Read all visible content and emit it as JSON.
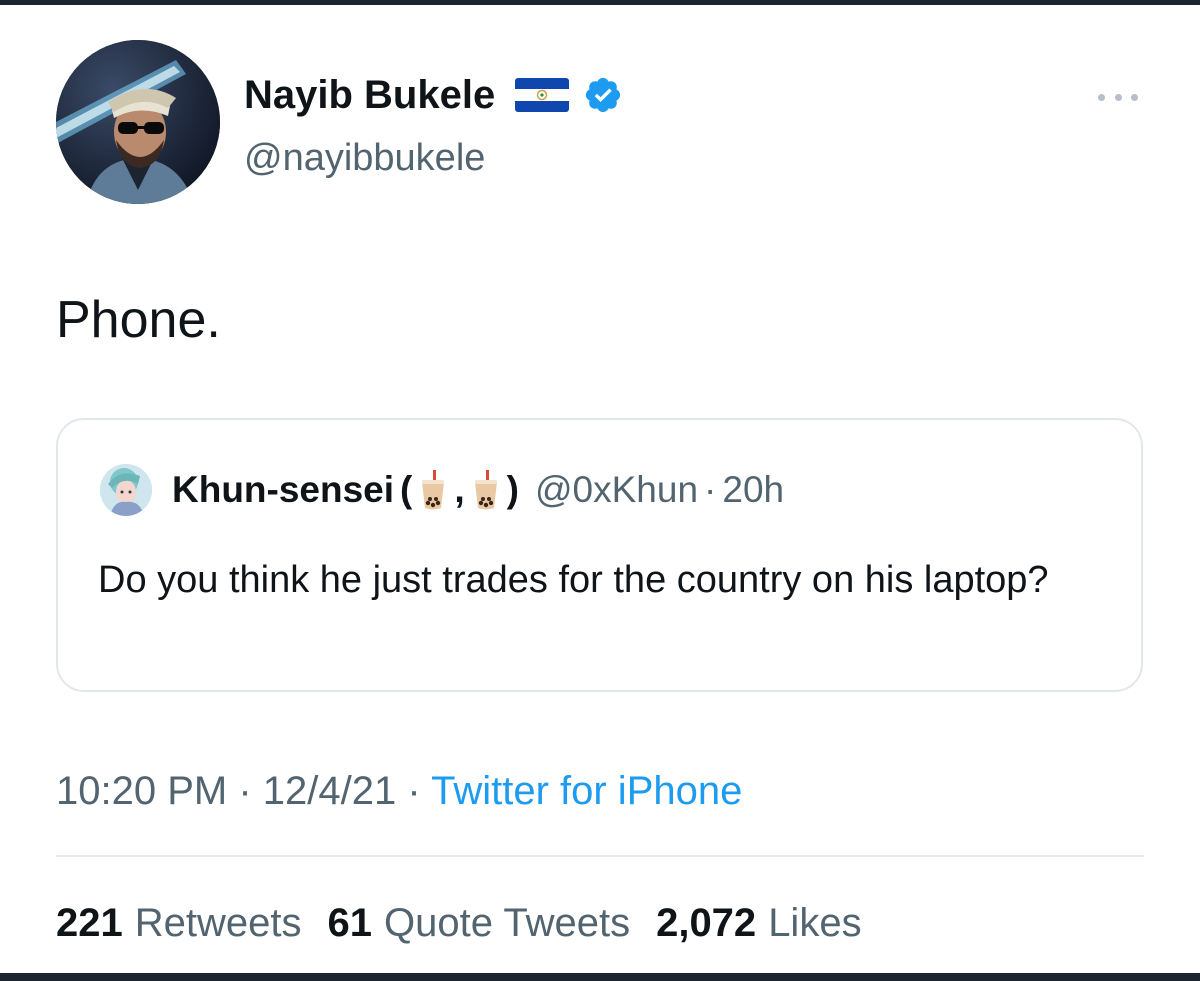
{
  "tweet": {
    "author": {
      "display_name": "Nayib Bukele",
      "handle": "@nayibbukele",
      "flag_icon": "el-salvador-flag-icon",
      "verified_icon": "verified-badge-icon"
    },
    "more_icon": "more-options-icon",
    "text": "Phone.",
    "quote": {
      "display_name": "Khun-sensei",
      "name_open": "(",
      "name_sep": ",",
      "name_close": ")",
      "name_emoji_icon": "bubble-tea-icon",
      "handle": "@0xKhun",
      "dot": "·",
      "time": "20h",
      "text": "Do you think he just trades for the country on his laptop?"
    },
    "meta": {
      "time": "10:20 PM",
      "dot": "·",
      "date": "12/4/21",
      "source": "Twitter for iPhone"
    },
    "stats": {
      "retweets_count": "221",
      "retweets_label": "Retweets",
      "quotes_count": "61",
      "quotes_label": "Quote Tweets",
      "likes_count": "2,072",
      "likes_label": "Likes"
    }
  },
  "colors": {
    "text_primary": "#0f1419",
    "text_secondary": "#536471",
    "link": "#1d9bf0",
    "verified": "#1d9bf0",
    "border": "#e1e8ed"
  }
}
